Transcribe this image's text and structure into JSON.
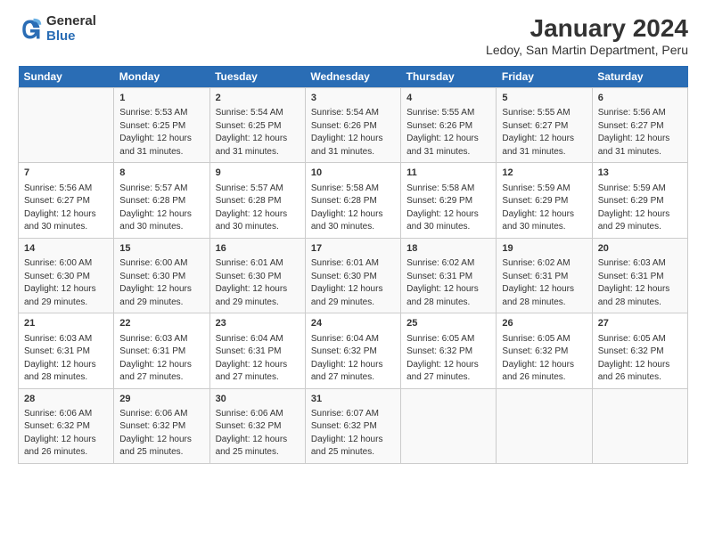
{
  "logo": {
    "general": "General",
    "blue": "Blue"
  },
  "title": "January 2024",
  "subtitle": "Ledoy, San Martin Department, Peru",
  "days_header": [
    "Sunday",
    "Monday",
    "Tuesday",
    "Wednesday",
    "Thursday",
    "Friday",
    "Saturday"
  ],
  "weeks": [
    [
      {
        "day": "",
        "content": ""
      },
      {
        "day": "1",
        "content": "Sunrise: 5:53 AM\nSunset: 6:25 PM\nDaylight: 12 hours\nand 31 minutes."
      },
      {
        "day": "2",
        "content": "Sunrise: 5:54 AM\nSunset: 6:25 PM\nDaylight: 12 hours\nand 31 minutes."
      },
      {
        "day": "3",
        "content": "Sunrise: 5:54 AM\nSunset: 6:26 PM\nDaylight: 12 hours\nand 31 minutes."
      },
      {
        "day": "4",
        "content": "Sunrise: 5:55 AM\nSunset: 6:26 PM\nDaylight: 12 hours\nand 31 minutes."
      },
      {
        "day": "5",
        "content": "Sunrise: 5:55 AM\nSunset: 6:27 PM\nDaylight: 12 hours\nand 31 minutes."
      },
      {
        "day": "6",
        "content": "Sunrise: 5:56 AM\nSunset: 6:27 PM\nDaylight: 12 hours\nand 31 minutes."
      }
    ],
    [
      {
        "day": "7",
        "content": "Sunrise: 5:56 AM\nSunset: 6:27 PM\nDaylight: 12 hours\nand 30 minutes."
      },
      {
        "day": "8",
        "content": "Sunrise: 5:57 AM\nSunset: 6:28 PM\nDaylight: 12 hours\nand 30 minutes."
      },
      {
        "day": "9",
        "content": "Sunrise: 5:57 AM\nSunset: 6:28 PM\nDaylight: 12 hours\nand 30 minutes."
      },
      {
        "day": "10",
        "content": "Sunrise: 5:58 AM\nSunset: 6:28 PM\nDaylight: 12 hours\nand 30 minutes."
      },
      {
        "day": "11",
        "content": "Sunrise: 5:58 AM\nSunset: 6:29 PM\nDaylight: 12 hours\nand 30 minutes."
      },
      {
        "day": "12",
        "content": "Sunrise: 5:59 AM\nSunset: 6:29 PM\nDaylight: 12 hours\nand 30 minutes."
      },
      {
        "day": "13",
        "content": "Sunrise: 5:59 AM\nSunset: 6:29 PM\nDaylight: 12 hours\nand 29 minutes."
      }
    ],
    [
      {
        "day": "14",
        "content": "Sunrise: 6:00 AM\nSunset: 6:30 PM\nDaylight: 12 hours\nand 29 minutes."
      },
      {
        "day": "15",
        "content": "Sunrise: 6:00 AM\nSunset: 6:30 PM\nDaylight: 12 hours\nand 29 minutes."
      },
      {
        "day": "16",
        "content": "Sunrise: 6:01 AM\nSunset: 6:30 PM\nDaylight: 12 hours\nand 29 minutes."
      },
      {
        "day": "17",
        "content": "Sunrise: 6:01 AM\nSunset: 6:30 PM\nDaylight: 12 hours\nand 29 minutes."
      },
      {
        "day": "18",
        "content": "Sunrise: 6:02 AM\nSunset: 6:31 PM\nDaylight: 12 hours\nand 28 minutes."
      },
      {
        "day": "19",
        "content": "Sunrise: 6:02 AM\nSunset: 6:31 PM\nDaylight: 12 hours\nand 28 minutes."
      },
      {
        "day": "20",
        "content": "Sunrise: 6:03 AM\nSunset: 6:31 PM\nDaylight: 12 hours\nand 28 minutes."
      }
    ],
    [
      {
        "day": "21",
        "content": "Sunrise: 6:03 AM\nSunset: 6:31 PM\nDaylight: 12 hours\nand 28 minutes."
      },
      {
        "day": "22",
        "content": "Sunrise: 6:03 AM\nSunset: 6:31 PM\nDaylight: 12 hours\nand 27 minutes."
      },
      {
        "day": "23",
        "content": "Sunrise: 6:04 AM\nSunset: 6:31 PM\nDaylight: 12 hours\nand 27 minutes."
      },
      {
        "day": "24",
        "content": "Sunrise: 6:04 AM\nSunset: 6:32 PM\nDaylight: 12 hours\nand 27 minutes."
      },
      {
        "day": "25",
        "content": "Sunrise: 6:05 AM\nSunset: 6:32 PM\nDaylight: 12 hours\nand 27 minutes."
      },
      {
        "day": "26",
        "content": "Sunrise: 6:05 AM\nSunset: 6:32 PM\nDaylight: 12 hours\nand 26 minutes."
      },
      {
        "day": "27",
        "content": "Sunrise: 6:05 AM\nSunset: 6:32 PM\nDaylight: 12 hours\nand 26 minutes."
      }
    ],
    [
      {
        "day": "28",
        "content": "Sunrise: 6:06 AM\nSunset: 6:32 PM\nDaylight: 12 hours\nand 26 minutes."
      },
      {
        "day": "29",
        "content": "Sunrise: 6:06 AM\nSunset: 6:32 PM\nDaylight: 12 hours\nand 25 minutes."
      },
      {
        "day": "30",
        "content": "Sunrise: 6:06 AM\nSunset: 6:32 PM\nDaylight: 12 hours\nand 25 minutes."
      },
      {
        "day": "31",
        "content": "Sunrise: 6:07 AM\nSunset: 6:32 PM\nDaylight: 12 hours\nand 25 minutes."
      },
      {
        "day": "",
        "content": ""
      },
      {
        "day": "",
        "content": ""
      },
      {
        "day": "",
        "content": ""
      }
    ]
  ]
}
